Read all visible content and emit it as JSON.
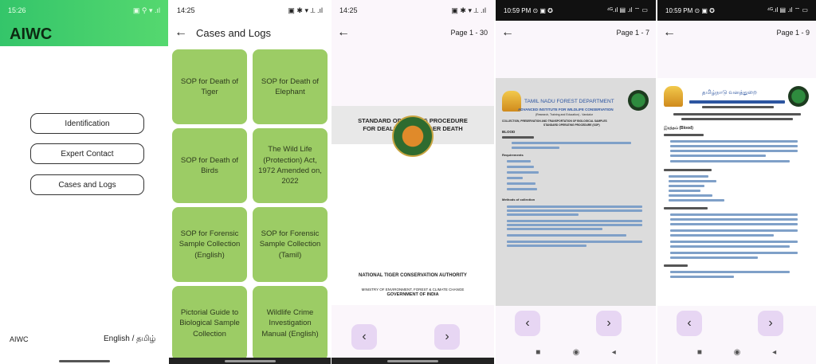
{
  "home": {
    "status_time": "15:26",
    "status_icons": "▣ ⚲ ▾ .ıl",
    "app_title": "AIWC",
    "buttons": [
      "Identification",
      "Expert Contact",
      "Cases and Logs"
    ],
    "footer_left": "AIWC",
    "footer_right": "English / தமிழ்"
  },
  "cases": {
    "status_time": "14:25",
    "status_icons": "▣ ✱ ▾ ⟂ .ıl",
    "title": "Cases and Logs",
    "cards": [
      "SOP for Death of Tiger",
      "SOP for Death of Elephant",
      "SOP for Death of Birds",
      "The Wild Life (Protection) Act, 1972 Amended on, 2022",
      "SOP for Forensic Sample Collection (English)",
      "SOP for Forensic Sample Collection (Tamil)",
      "Pictorial Guide to Biological Sample Collection",
      "Wildlife Crime Investigation Manual (English)"
    ]
  },
  "viewer1": {
    "status_time": "14:25",
    "status_icons": "▣ ✱ ▾ ⟂ .ıl",
    "page_indicator": "Page 1 - 30",
    "doc_title_line1": "STANDARD OPERATING PROCEDURE",
    "doc_title_line2": "FOR DEALING WITH TIGER DEATH",
    "authority": "NATIONAL TIGER CONSERVATION AUTHORITY",
    "ministry": "MINISTRY OF ENVIRONMENT, FOREST & CLIMATE CHANGE",
    "government": "GOVERNMENT OF INDIA",
    "prev": "‹",
    "next": "›"
  },
  "viewer2": {
    "status_time": "10:59 PM ⊙ ▣ ✪",
    "status_icons": "⁴ᴳ.ıl ▤ .ıl ⌔ ▭",
    "page_indicator": "Page 1 - 7",
    "dept": "TAMIL NADU FOREST DEPARTMENT",
    "institute": "ADVANCED INSTITUTE FOR WILDLIFE CONSERVATION",
    "subline": "(Research, Training and Education) - Vandalur",
    "sop_title": "COLLECTION, PRESERVATION AND TRANSPORTATION OF BIOLOGICAL SAMPLES",
    "sop_sub": "STANDARD OPERATING PROCEDURE (SOP)",
    "section_blood": "BLOOD",
    "section_requirements": "Requirements",
    "section_methods": "Methods of collection",
    "prev": "‹",
    "next": "›"
  },
  "viewer3": {
    "status_time": "10:59 PM ⊙ ▣ ✪",
    "status_icons": "⁴ᴳ.ıl ▤ .ıl ⌔ ▭",
    "page_indicator": "Page 1 - 9",
    "dept": "தமிழ்நாடு வனத்துறை",
    "blood": "இரத்தம் (Blood)",
    "prev": "‹",
    "next": "›"
  },
  "sysnav": {
    "back": "◂",
    "home": "◉",
    "recent": "■"
  }
}
